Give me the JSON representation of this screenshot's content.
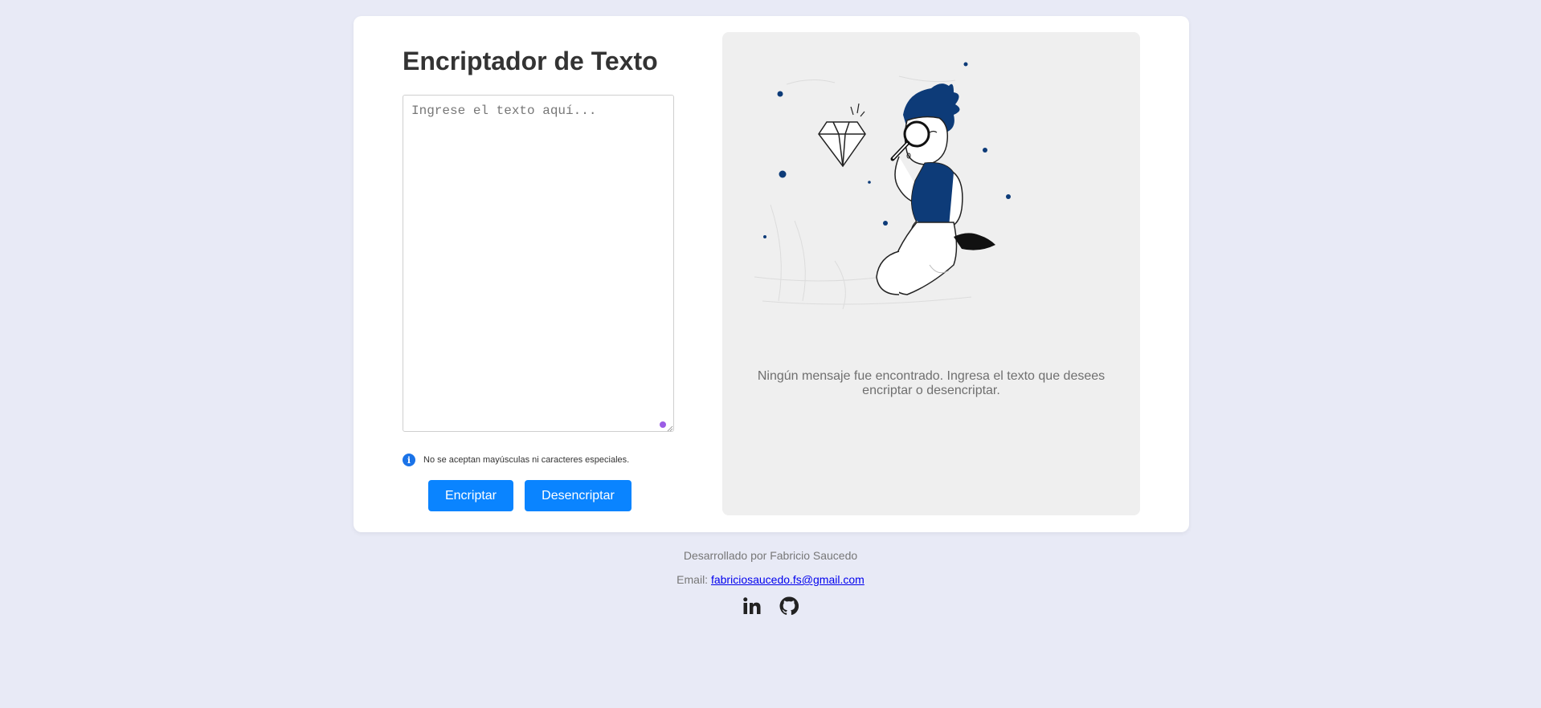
{
  "app": {
    "title": "Encriptador de Texto"
  },
  "input": {
    "placeholder": "Ingrese el texto aquí...",
    "value": ""
  },
  "hint": {
    "icon": "info-icon",
    "text": "No se aceptan mayúsculas ni caracteres especiales."
  },
  "buttons": {
    "encrypt_label": "Encriptar",
    "decrypt_label": "Desencriptar"
  },
  "output": {
    "illustration": "person-with-magnifier-illustration",
    "empty_message": "Ningún mensaje fue encontrado. Ingresa el texto que desees encriptar o desencriptar."
  },
  "footer": {
    "developed_by": "Desarrollado por Fabricio Saucedo",
    "email_label": "Email:",
    "email": "fabriciosaucedo.fs@gmail.com",
    "socials": [
      {
        "name": "linkedin-icon"
      },
      {
        "name": "github-icon"
      }
    ]
  },
  "colors": {
    "page_background": "#e8eaf6",
    "accent": "#0a84ff",
    "panel_background": "#efefef",
    "illustration_navy": "#0d3b78"
  }
}
